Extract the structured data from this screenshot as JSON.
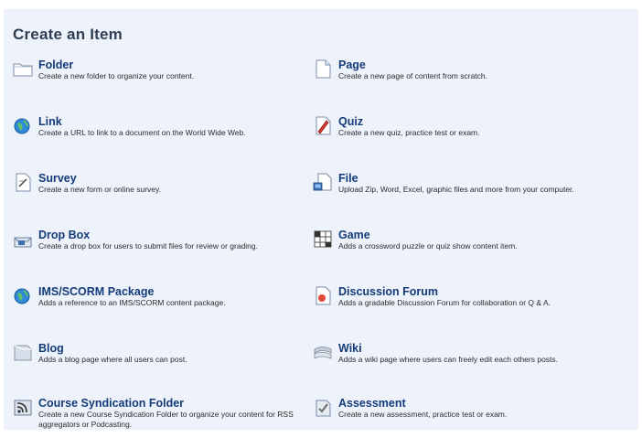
{
  "title": "Create an Item",
  "items": [
    {
      "name": "Folder",
      "icon": "folder-icon",
      "desc": "Create a new folder to organize your content."
    },
    {
      "name": "Page",
      "icon": "page-icon",
      "desc": "Create a new page of content from scratch."
    },
    {
      "name": "Link",
      "icon": "link-globe-icon",
      "desc": "Create a URL to link to a document on the World Wide Web."
    },
    {
      "name": "Quiz",
      "icon": "quiz-icon",
      "desc": "Create a new quiz, practice test or exam."
    },
    {
      "name": "Survey",
      "icon": "survey-icon",
      "desc": "Create a new form or online survey."
    },
    {
      "name": "File",
      "icon": "file-upload-icon",
      "desc": "Upload Zip, Word, Excel, graphic files and more from your computer."
    },
    {
      "name": "Drop Box",
      "icon": "drop-box-icon",
      "desc": "Create a drop box for users to submit files for review or grading."
    },
    {
      "name": "Game",
      "icon": "game-grid-icon",
      "desc": "Adds a crossword puzzle or quiz show content item."
    },
    {
      "name": "IMS/SCORM Package",
      "icon": "package-globe-icon",
      "desc": "Adds a reference to an IMS/SCORM content package."
    },
    {
      "name": "Discussion Forum",
      "icon": "discussion-forum-icon",
      "desc": "Adds a gradable Discussion Forum for collaboration or Q & A."
    },
    {
      "name": "Blog",
      "icon": "blog-icon",
      "desc": "Adds a blog page where all users can post."
    },
    {
      "name": "Wiki",
      "icon": "wiki-icon",
      "desc": "Adds a wiki page where users can freely edit each others posts."
    },
    {
      "name": "Course Syndication Folder",
      "icon": "rss-folder-icon",
      "desc": "Create a new Course Syndication Folder to organize your content for RSS aggregators or Podcasting."
    },
    {
      "name": "Assessment",
      "icon": "assessment-icon",
      "desc": "Create a new assessment, practice test or exam."
    }
  ]
}
